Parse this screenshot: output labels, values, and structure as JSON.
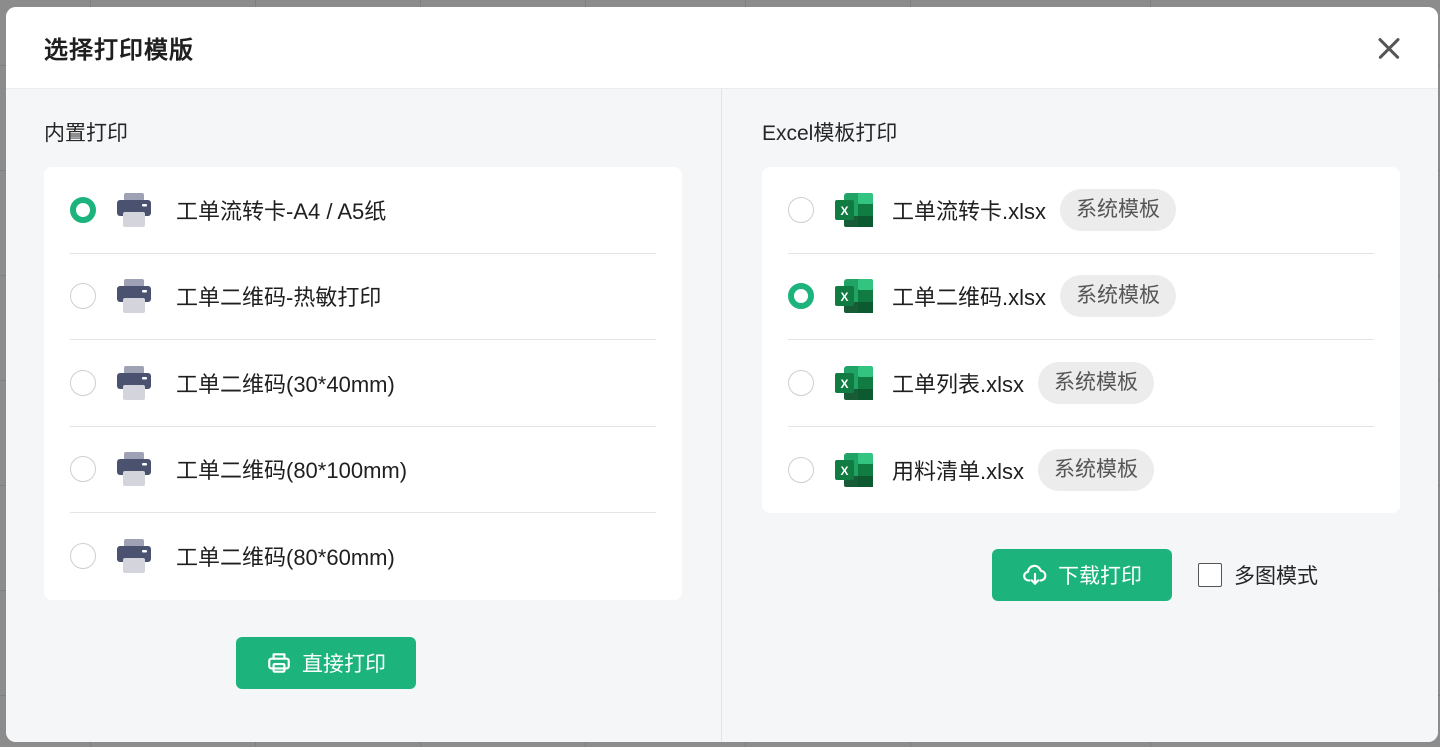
{
  "modal": {
    "title": "选择打印模版"
  },
  "builtin": {
    "title": "内置打印",
    "items": [
      {
        "label": "工单流转卡-A4 / A5纸",
        "selected": true
      },
      {
        "label": "工单二维码-热敏打印",
        "selected": false
      },
      {
        "label": "工单二维码(30*40mm)",
        "selected": false
      },
      {
        "label": "工单二维码(80*100mm)",
        "selected": false
      },
      {
        "label": "工单二维码(80*60mm)",
        "selected": false
      }
    ],
    "print_button": "直接打印"
  },
  "excel": {
    "title": "Excel模板打印",
    "items": [
      {
        "label": "工单流转卡.xlsx",
        "tag": "系统模板",
        "selected": false
      },
      {
        "label": "工单二维码.xlsx",
        "tag": "系统模板",
        "selected": true
      },
      {
        "label": "工单列表.xlsx",
        "tag": "系统模板",
        "selected": false
      },
      {
        "label": "用料清单.xlsx",
        "tag": "系统模板",
        "selected": false
      }
    ],
    "download_button": "下载打印",
    "multi_image_checkbox": {
      "label": "多图模式",
      "checked": false
    }
  },
  "colors": {
    "accent": "#1cb47c",
    "excel_green": "#1d6f42",
    "printer_dark": "#4b5270"
  },
  "icons": {
    "close": "close-icon",
    "printer": "printer-icon",
    "excel": "excel-file-icon",
    "print_button": "printer-outline-icon",
    "download_button": "cloud-download-icon"
  }
}
